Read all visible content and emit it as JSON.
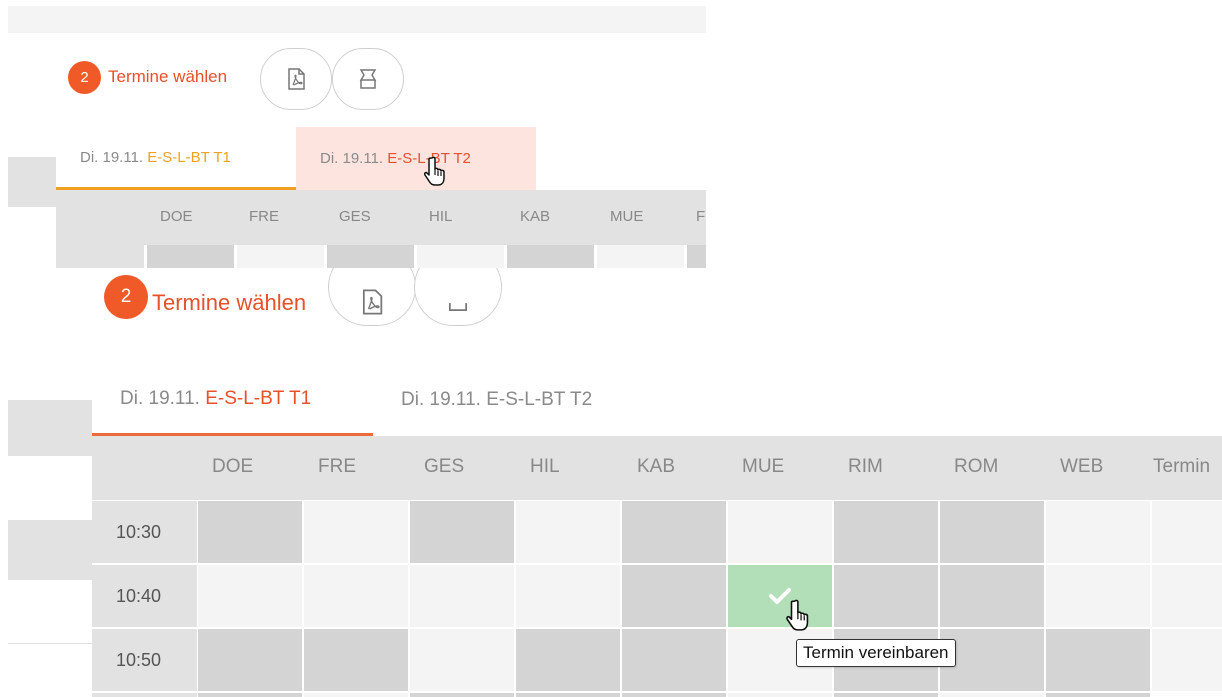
{
  "step": {
    "number": "2",
    "label": "Termine wählen"
  },
  "icons": {
    "pdf": "pdf-icon",
    "print": "print-icon",
    "check": "check-icon",
    "cursor": "hand-pointer-icon"
  },
  "tabs": [
    {
      "date": "Di. 19.11.",
      "code": "E-S-L-BT T1"
    },
    {
      "date": "Di. 19.11.",
      "code": "E-S-L-BT T2"
    }
  ],
  "top_columns": [
    "DOE",
    "FRE",
    "GES",
    "HIL",
    "KAB",
    "MUE",
    "F"
  ],
  "columns": [
    "DOE",
    "FRE",
    "GES",
    "HIL",
    "KAB",
    "MUE",
    "RIM",
    "ROM",
    "WEB",
    "Termin"
  ],
  "times": [
    "10:30",
    "10:40",
    "10:50"
  ],
  "tooltip": "Termin vereinbaren",
  "colors": {
    "accent": "#e8502a",
    "badge": "#f05a28",
    "tab_active_top": "#f0a020",
    "tab_hover": "#fde4df",
    "booked": "#d4d4d4",
    "free": "#f4f4f4",
    "selected": "#b3dfb8"
  }
}
